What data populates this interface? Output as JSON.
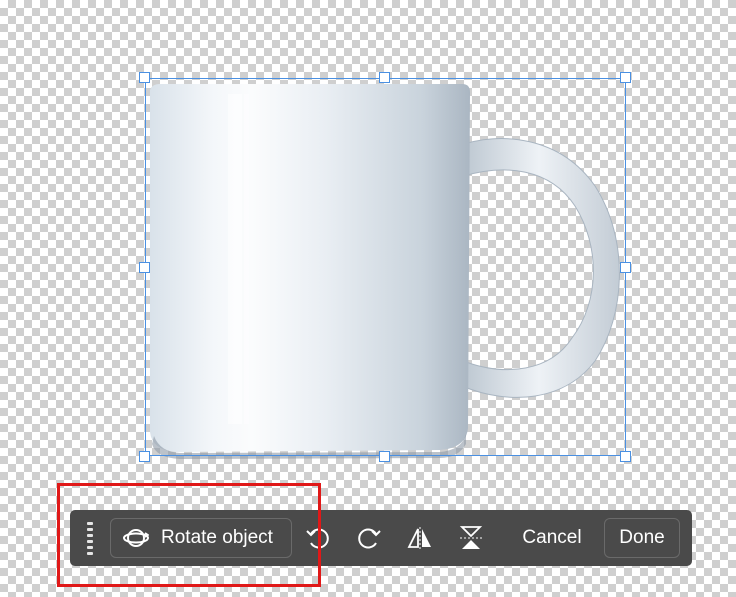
{
  "toolbar": {
    "rotate_label": "Rotate object",
    "cancel_label": "Cancel",
    "done_label": "Done"
  },
  "icons": {
    "grip": "drag-handle-icon",
    "rotate_object": "rotate-object-icon",
    "rotate_left": "rotate-left-icon",
    "rotate_right": "rotate-right-icon",
    "flip_horizontal": "flip-horizontal-icon",
    "flip_vertical": "flip-vertical-icon"
  },
  "colors": {
    "selection": "#4a90e2",
    "toolbar_bg": "#4a4a4a",
    "highlight": "#e01818"
  }
}
